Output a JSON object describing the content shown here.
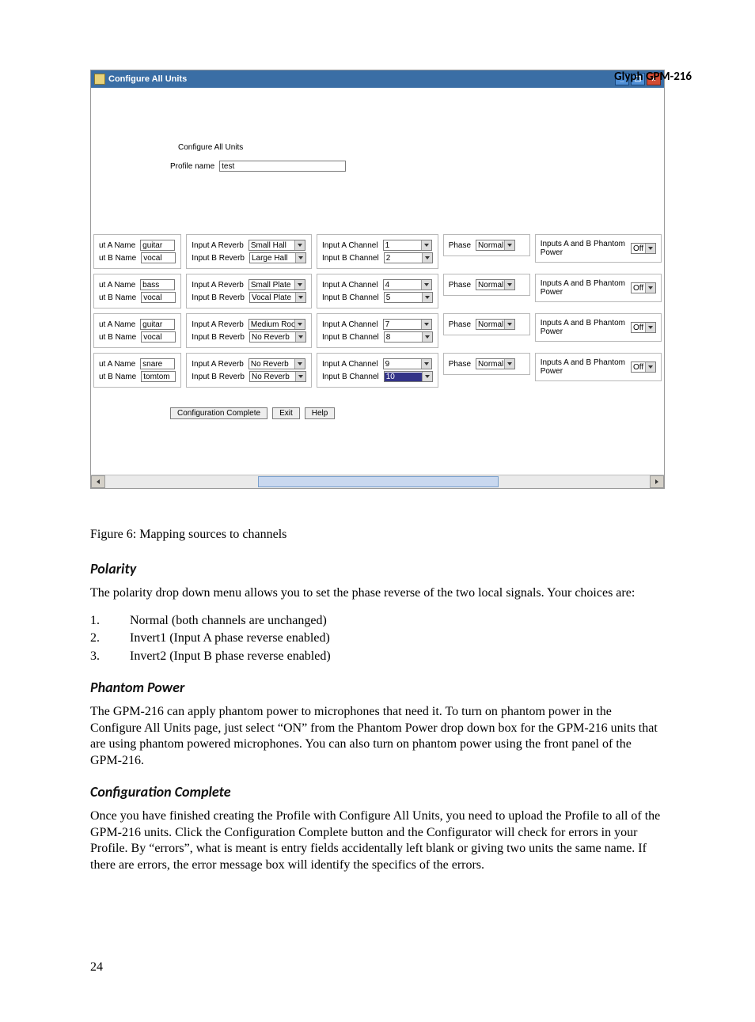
{
  "doc_header": "Glyph GPM-216",
  "window": {
    "title": "Configure All Units",
    "btn_min": "_",
    "btn_max": "❐",
    "btn_close": "×"
  },
  "form": {
    "heading": "Configure All Units",
    "profile_label": "Profile name",
    "profile_value": "test",
    "labels": {
      "nameA": "ut A Name",
      "nameB": "ut B Name",
      "revA": "Input A Reverb",
      "revB": "Input B Reverb",
      "chA": "Input A Channel",
      "chB": "Input B Channel",
      "phase": "Phase",
      "phantom": "Inputs A and B Phantom Power"
    },
    "rows": [
      {
        "na": "guitar",
        "nb": "vocal",
        "ra": "Small Hall",
        "rb": "Large Hall",
        "ca": "1",
        "cb": "2",
        "ph": "Normal",
        "pp": "Off"
      },
      {
        "na": "bass",
        "nb": "vocal",
        "ra": "Small Plate",
        "rb": "Vocal Plate",
        "ca": "4",
        "cb": "5",
        "ph": "Normal",
        "pp": "Off"
      },
      {
        "na": "guitar",
        "nb": "vocal",
        "ra": "Medium Room",
        "rb": "No Reverb",
        "ca": "7",
        "cb": "8",
        "ph": "Normal",
        "pp": "Off"
      },
      {
        "na": "snare",
        "nb": "tomtom",
        "ra": "No Reverb",
        "rb": "No Reverb",
        "ca": "9",
        "cb": "10",
        "ph": "Normal",
        "pp": "Off"
      }
    ],
    "buttons": {
      "complete": "Configuration Complete",
      "exit": "Exit",
      "help": "Help"
    }
  },
  "caption": "Figure 6: Mapping sources to channels",
  "sections": {
    "polarity_h": "Polarity",
    "polarity_p": "The polarity drop down menu allows you to set the phase reverse of the two local signals. Your choices are:",
    "list": [
      {
        "n": "1.",
        "t": "Normal (both channels are unchanged)"
      },
      {
        "n": "2.",
        "t": "Invert1 (Input A phase reverse enabled)"
      },
      {
        "n": "3.",
        "t": "Invert2 (Input B phase reverse enabled)"
      }
    ],
    "phantom_h": "Phantom Power",
    "phantom_p": "The GPM-216 can apply phantom power to microphones that need it. To turn on phantom power in the Configure All Units page, just select “ON” from the Phantom Power drop down box for the GPM-216 units that are using phantom powered microphones. You can also turn on phantom power using the front panel of the GPM-216.",
    "config_h": "Configuration Complete",
    "config_p": "Once you have finished creating the Profile with Configure All Units, you need to upload the Profile to all of the GPM-216 units. Click the Configuration Complete button and the Configurator will check for errors in your Profile. By “errors”, what is meant is entry fields accidentally left blank or giving two units the same name.  If there are errors, the error message box will identify the specifics of the errors."
  },
  "page_number": "24"
}
